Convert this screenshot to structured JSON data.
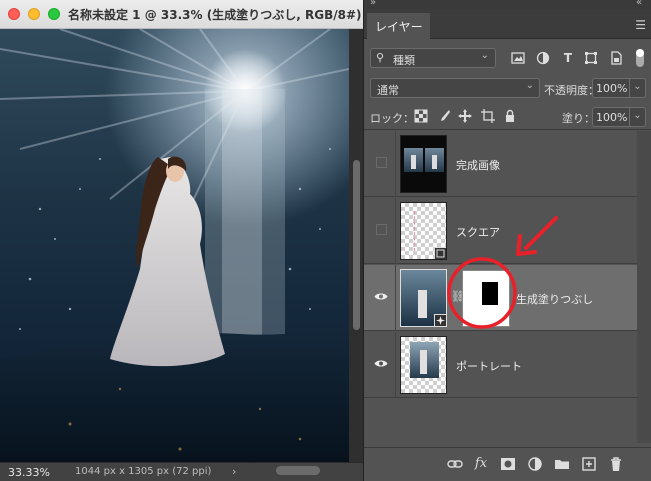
{
  "document": {
    "title": "名称未設定 1 @ 33.3% (生成塗りつぶし, RGB/8#) *",
    "zoom": "33.33%",
    "doc_info": "1044 px x 1305 px (72 ppi)",
    "status_arrow": "›"
  },
  "panel": {
    "tab": "レイヤー",
    "filter_kind": "種類",
    "blend_mode": "通常",
    "opacity_label": "不透明度：",
    "opacity_value": "100%",
    "lock_label": "ロック：",
    "fill_label": "塗り：",
    "fill_value": "100%"
  },
  "layers": [
    {
      "name": "完成画像",
      "visible": false,
      "selected": false
    },
    {
      "name": "スクエア",
      "visible": false,
      "selected": false
    },
    {
      "name": "生成塗りつぶし",
      "visible": true,
      "selected": true
    },
    {
      "name": "ポートレート",
      "visible": true,
      "selected": false
    }
  ],
  "colors": {
    "panel_bg": "#535353",
    "selected_row": "#6e6e6e",
    "annotation_red": "#e8202a"
  }
}
